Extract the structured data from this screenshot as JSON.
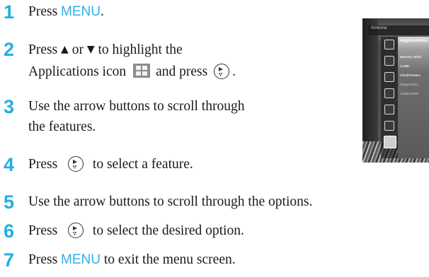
{
  "steps": [
    {
      "num": "1",
      "parts": [
        "Press ",
        "MENU",
        "."
      ]
    },
    {
      "num": "2",
      "line1": [
        "Press ",
        "▲",
        " or ",
        "▼",
        " to highlight the"
      ],
      "line2": [
        "Applications icon",
        "and press",
        "."
      ]
    },
    {
      "num": "3",
      "line1": "Use the arrow buttons to scroll through",
      "line2": "the features."
    },
    {
      "num": "4",
      "before": "Press",
      "after": "to select a feature."
    },
    {
      "num": "5",
      "text": "Use the arrow buttons to scroll through the options."
    },
    {
      "num": "6",
      "before": "Press",
      "after": "to select the desired option."
    },
    {
      "num": "7",
      "before": "Press ",
      "key": "MENU",
      "after": " to exit the menu screen."
    }
  ],
  "menu_screen": {
    "header": "Antenna",
    "title": "Applications",
    "items": [
      "Memory Stick",
      "i.LINK",
      "Clock/Timers",
      "Diagnostics",
      "CableCARD"
    ],
    "dim_items": [
      "Diagnostics",
      "CableCARD"
    ],
    "rail_icons": [
      "profile-icon",
      "sound-icon",
      "screen-icon",
      "channel-icon",
      "parental-icon",
      "setup-icon",
      "applications-icon"
    ]
  },
  "colors": {
    "step_number": "#22aee6",
    "keyword": "#2fb0e8"
  }
}
